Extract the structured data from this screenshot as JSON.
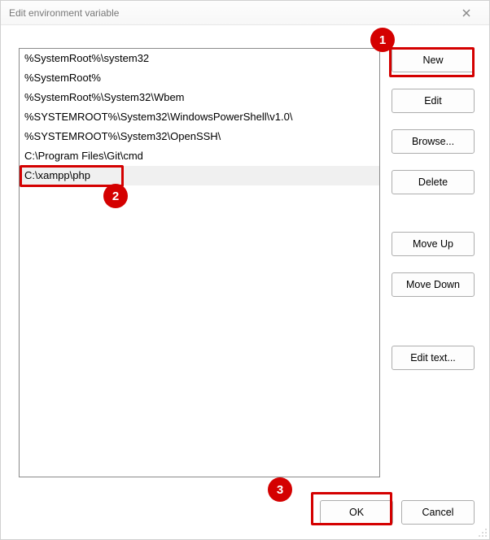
{
  "window": {
    "title": "Edit environment variable"
  },
  "entries": [
    {
      "text": "%SystemRoot%\\system32",
      "selected": false
    },
    {
      "text": "%SystemRoot%",
      "selected": false
    },
    {
      "text": "%SystemRoot%\\System32\\Wbem",
      "selected": false
    },
    {
      "text": "%SYSTEMROOT%\\System32\\WindowsPowerShell\\v1.0\\",
      "selected": false
    },
    {
      "text": "%SYSTEMROOT%\\System32\\OpenSSH\\",
      "selected": false
    },
    {
      "text": "C:\\Program Files\\Git\\cmd",
      "selected": false
    },
    {
      "text": "C:\\xampp\\php",
      "selected": true
    }
  ],
  "side": {
    "new": "New",
    "edit": "Edit",
    "browse": "Browse...",
    "delete": "Delete",
    "moveup": "Move Up",
    "movedown": "Move Down",
    "edittext": "Edit text..."
  },
  "footer": {
    "ok": "OK",
    "cancel": "Cancel"
  },
  "callouts": {
    "one": "1",
    "two": "2",
    "three": "3"
  },
  "accent_red": "#d40000"
}
